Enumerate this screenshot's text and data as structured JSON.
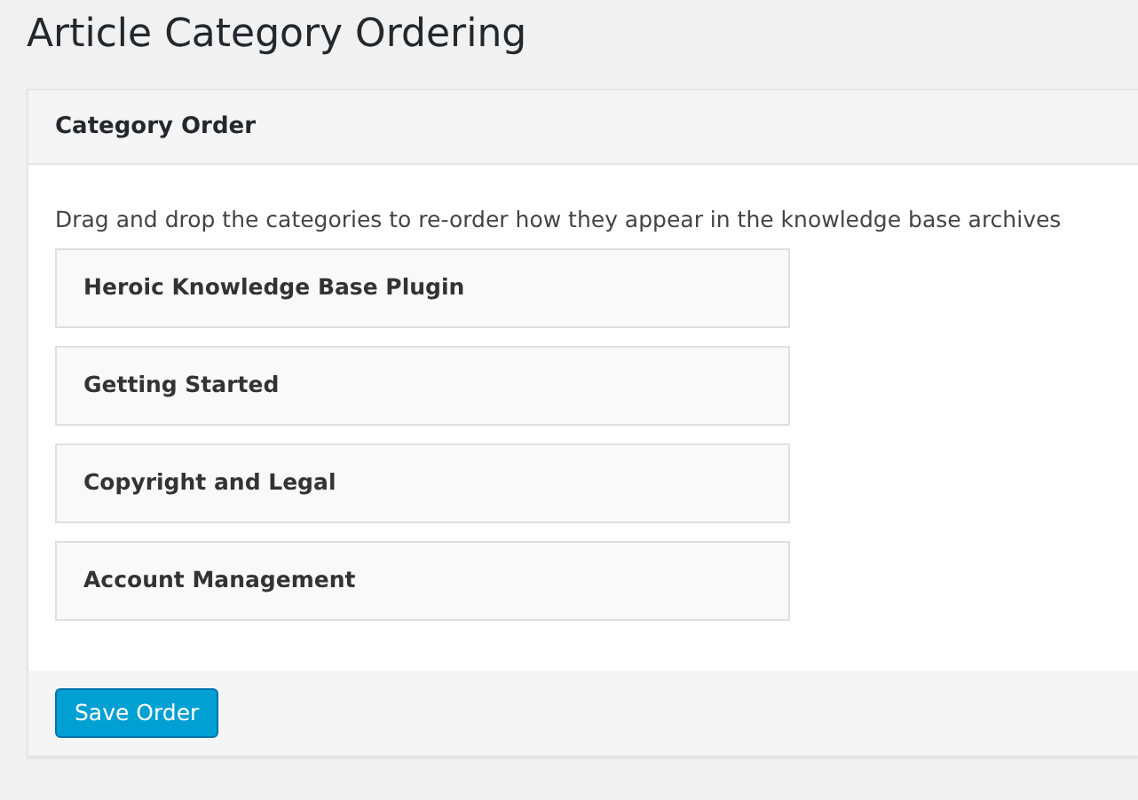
{
  "page": {
    "title": "Article Category Ordering"
  },
  "panel": {
    "title": "Category Order",
    "instructions": "Drag and drop the categories to re-order how they appear in the knowledge base archives"
  },
  "categories": [
    {
      "label": "Heroic Knowledge Base Plugin"
    },
    {
      "label": "Getting Started"
    },
    {
      "label": "Copyright and Legal"
    },
    {
      "label": "Account Management"
    }
  ],
  "buttons": [
    {
      "label": "Save Order"
    }
  ]
}
